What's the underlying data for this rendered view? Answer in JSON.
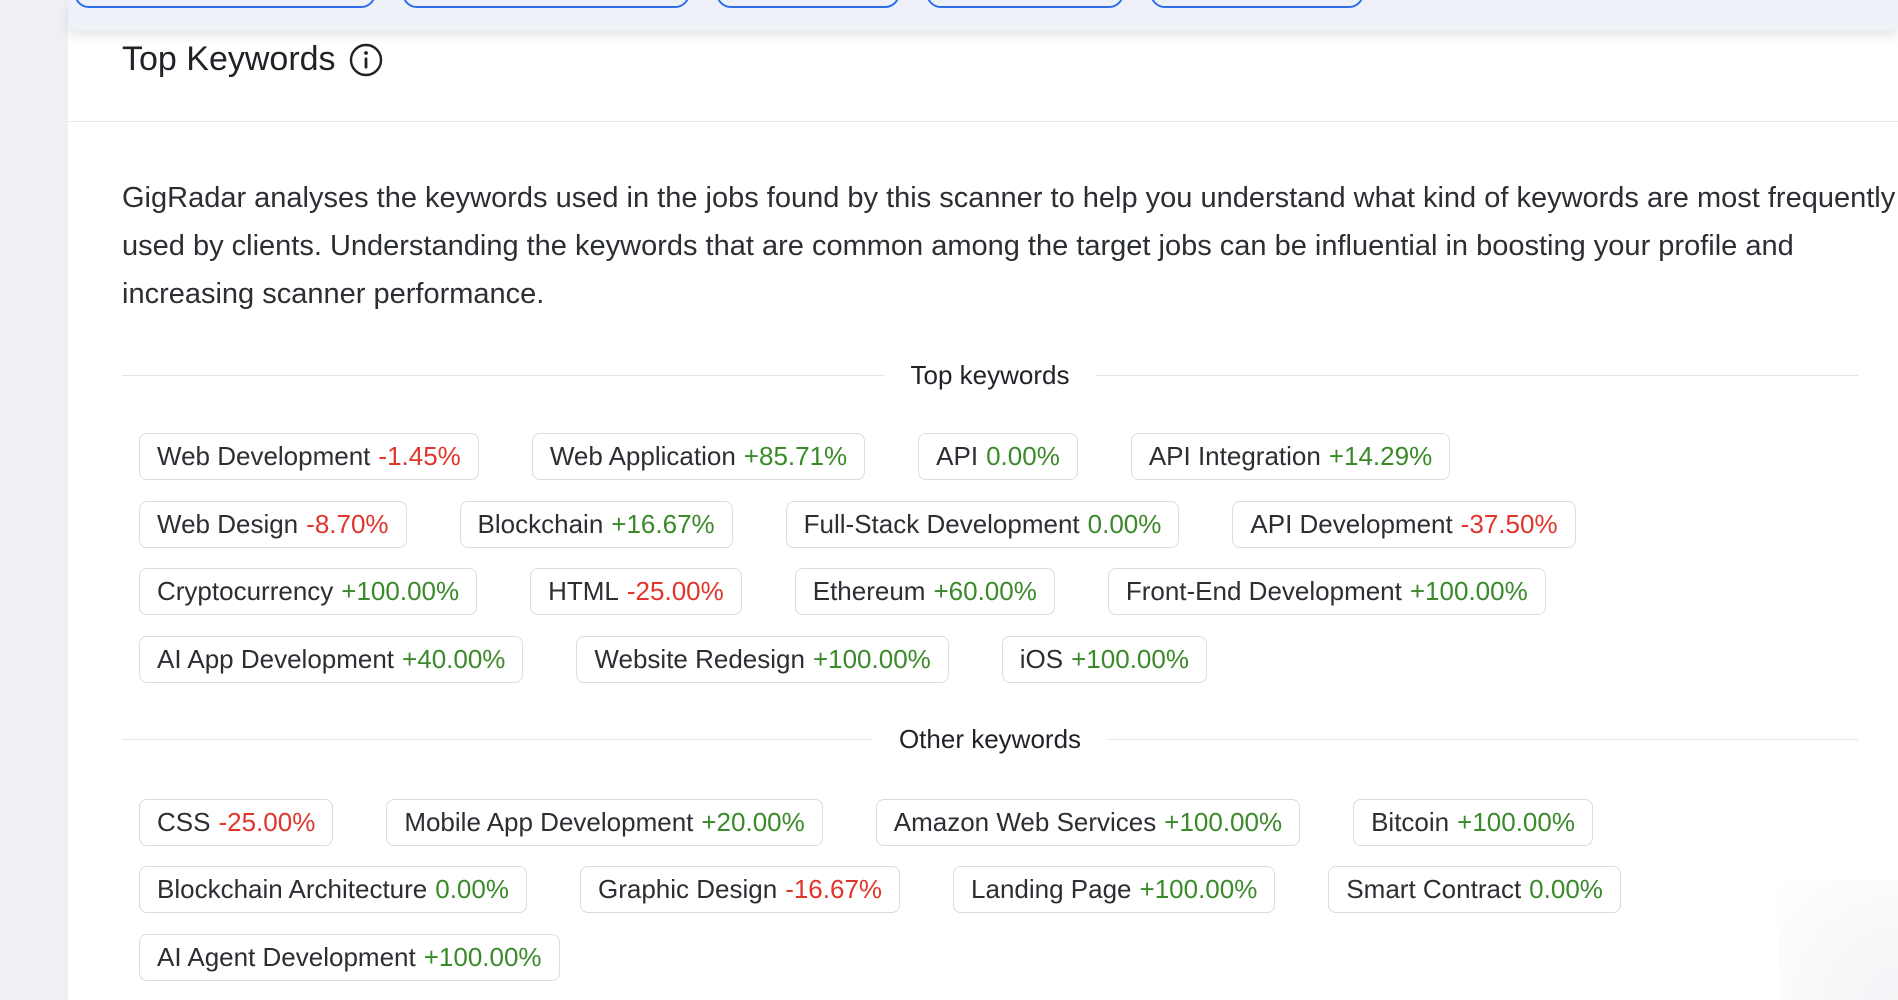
{
  "header": {
    "title": "Top Keywords",
    "info_icon": "info-circle-icon"
  },
  "description": "GigRadar analyses the keywords used in the jobs found by this scanner to help you understand what kind of keywords are most frequently used by clients. Understanding the keywords that are common among the target jobs can be influential in boosting your profile and increasing scanner performance.",
  "sections": {
    "top": {
      "label": "Top keywords",
      "rows": [
        [
          {
            "keyword": "Web Development",
            "change": "-1.45%",
            "trend": "neg"
          },
          {
            "keyword": "Web Application",
            "change": "+85.71%",
            "trend": "pos"
          },
          {
            "keyword": "API",
            "change": "0.00%",
            "trend": "zero"
          },
          {
            "keyword": "API Integration",
            "change": "+14.29%",
            "trend": "pos"
          }
        ],
        [
          {
            "keyword": "Web Design",
            "change": "-8.70%",
            "trend": "neg"
          },
          {
            "keyword": "Blockchain",
            "change": "+16.67%",
            "trend": "pos"
          },
          {
            "keyword": "Full-Stack Development",
            "change": "0.00%",
            "trend": "zero"
          },
          {
            "keyword": "API Development",
            "change": "-37.50%",
            "trend": "neg"
          }
        ],
        [
          {
            "keyword": "Cryptocurrency",
            "change": "+100.00%",
            "trend": "pos"
          },
          {
            "keyword": "HTML",
            "change": "-25.00%",
            "trend": "neg"
          },
          {
            "keyword": "Ethereum",
            "change": "+60.00%",
            "trend": "pos"
          },
          {
            "keyword": "Front-End Development",
            "change": "+100.00%",
            "trend": "pos"
          }
        ],
        [
          {
            "keyword": "AI App Development",
            "change": "+40.00%",
            "trend": "pos"
          },
          {
            "keyword": "Website Redesign",
            "change": "+100.00%",
            "trend": "pos"
          },
          {
            "keyword": "iOS",
            "change": "+100.00%",
            "trend": "pos"
          }
        ]
      ]
    },
    "other": {
      "label": "Other keywords",
      "rows": [
        [
          {
            "keyword": "CSS",
            "change": "-25.00%",
            "trend": "neg"
          },
          {
            "keyword": "Mobile App Development",
            "change": "+20.00%",
            "trend": "pos"
          },
          {
            "keyword": "Amazon Web Services",
            "change": "+100.00%",
            "trend": "pos"
          },
          {
            "keyword": "Bitcoin",
            "change": "+100.00%",
            "trend": "pos"
          }
        ],
        [
          {
            "keyword": "Blockchain Architecture",
            "change": "0.00%",
            "trend": "zero"
          },
          {
            "keyword": "Graphic Design",
            "change": "-16.67%",
            "trend": "neg"
          },
          {
            "keyword": "Landing Page",
            "change": "+100.00%",
            "trend": "pos"
          },
          {
            "keyword": "Smart Contract",
            "change": "0.00%",
            "trend": "zero"
          }
        ],
        [
          {
            "keyword": "AI Agent Development",
            "change": "+100.00%",
            "trend": "pos"
          }
        ]
      ]
    }
  },
  "colors": {
    "positive": "#3a8a2a",
    "negative": "#e0352b",
    "tab_border": "#2f6fed"
  }
}
